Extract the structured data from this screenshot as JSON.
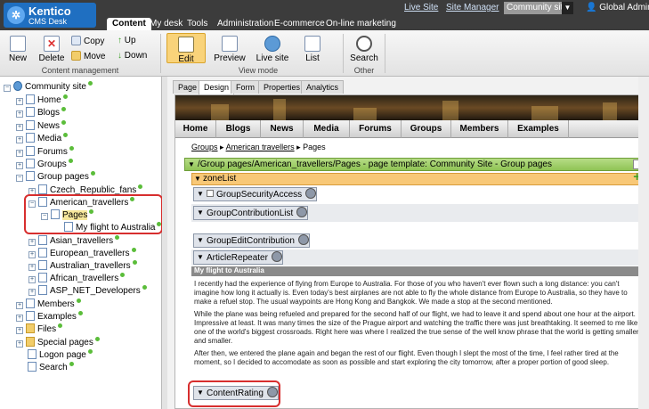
{
  "header": {
    "logo_name": "Kentico",
    "logo_sub": "CMS Desk",
    "links": [
      "Live Site",
      "Site Manager"
    ],
    "site_select": "Community site",
    "user": "Global Administrator",
    "tabs": [
      "Content",
      "My desk",
      "Tools",
      "Administration",
      "E-commerce",
      "On-line marketing"
    ]
  },
  "ribbon": {
    "new": "New",
    "delete": "Delete",
    "copy": "Copy",
    "move": "Move",
    "up": "Up",
    "down": "Down",
    "group_content": "Content management",
    "edit": "Edit",
    "preview": "Preview",
    "live_site": "Live site",
    "list": "List",
    "group_view": "View mode",
    "search": "Search",
    "group_other": "Other"
  },
  "tree": {
    "root": "Community site",
    "home": "Home",
    "blogs": "Blogs",
    "news": "News",
    "media": "Media",
    "forums": "Forums",
    "groups": "Groups",
    "group_pages": "Group pages",
    "czech": "Czech_Republic_fans",
    "american": "American_travellers",
    "pages": "Pages",
    "flight": "My flight to Australia",
    "asian": "Asian_travellers",
    "european": "European_travellers",
    "australian": "Australian_travellers",
    "african": "African_travellers",
    "aspnet": "ASP_NET_Developers",
    "members": "Members",
    "examples": "Examples",
    "files": "Files",
    "special": "Special pages",
    "logon": "Logon page",
    "search": "Search"
  },
  "view_tabs": [
    "Page",
    "Design",
    "Form",
    "Properties",
    "Analytics"
  ],
  "site_menu": [
    "Home",
    "Blogs",
    "News",
    "Media",
    "Forums",
    "Groups",
    "Members",
    "Examples"
  ],
  "breadcrumb": {
    "groups": "Groups",
    "american": "American travellers",
    "pages": "Pages"
  },
  "page_template_bar": "/Group pages/American_travellers/Pages - page template: Community Site - Group pages",
  "zone": "zoneList",
  "webparts": {
    "security": "GroupSecurityAccess",
    "contrib_list": "GroupContributionList",
    "edit_contrib": "GroupEditContribution",
    "repeater": "ArticleRepeater",
    "rating": "ContentRating"
  },
  "article": {
    "title": "My flight to Australia",
    "p1": "I recently had the experience of flying from Europe to Australia. For those of you who haven't ever flown such a long distance: you can't imagine how long it actually is. Even today's best airplanes are not able to fly the whole distance from Europe to Australia, so they have to make a refuel stop. The usual waypoints are Hong Kong and Bangkok. We made a stop at the second mentioned.",
    "p2": "While the plane was being refueled and prepared for the second half of our flight, we had to leave it and spend about one hour at the airport. Impressive at least. It was many times the size of the Prague airport and watching the traffic there was just breathtaking. It seemed to me like one of the world's biggest crossroads. Right here was where I realized the true sense of the well know phrase that the world is getting smaller and smaller.",
    "p3": "After then, we entered the plane again and began the rest of our flight. Even though I slept the most of the time, I feel rather tired at the moment, so I decided to accomodate as soon as possible and start exploring the city tomorrow, after a proper portion of good sleep."
  },
  "colors": {
    "top_bar": "#3c3c3c",
    "highlight": "#d72e2e",
    "template_bar": "#8fc455",
    "zone_bar": "#f8c877"
  }
}
